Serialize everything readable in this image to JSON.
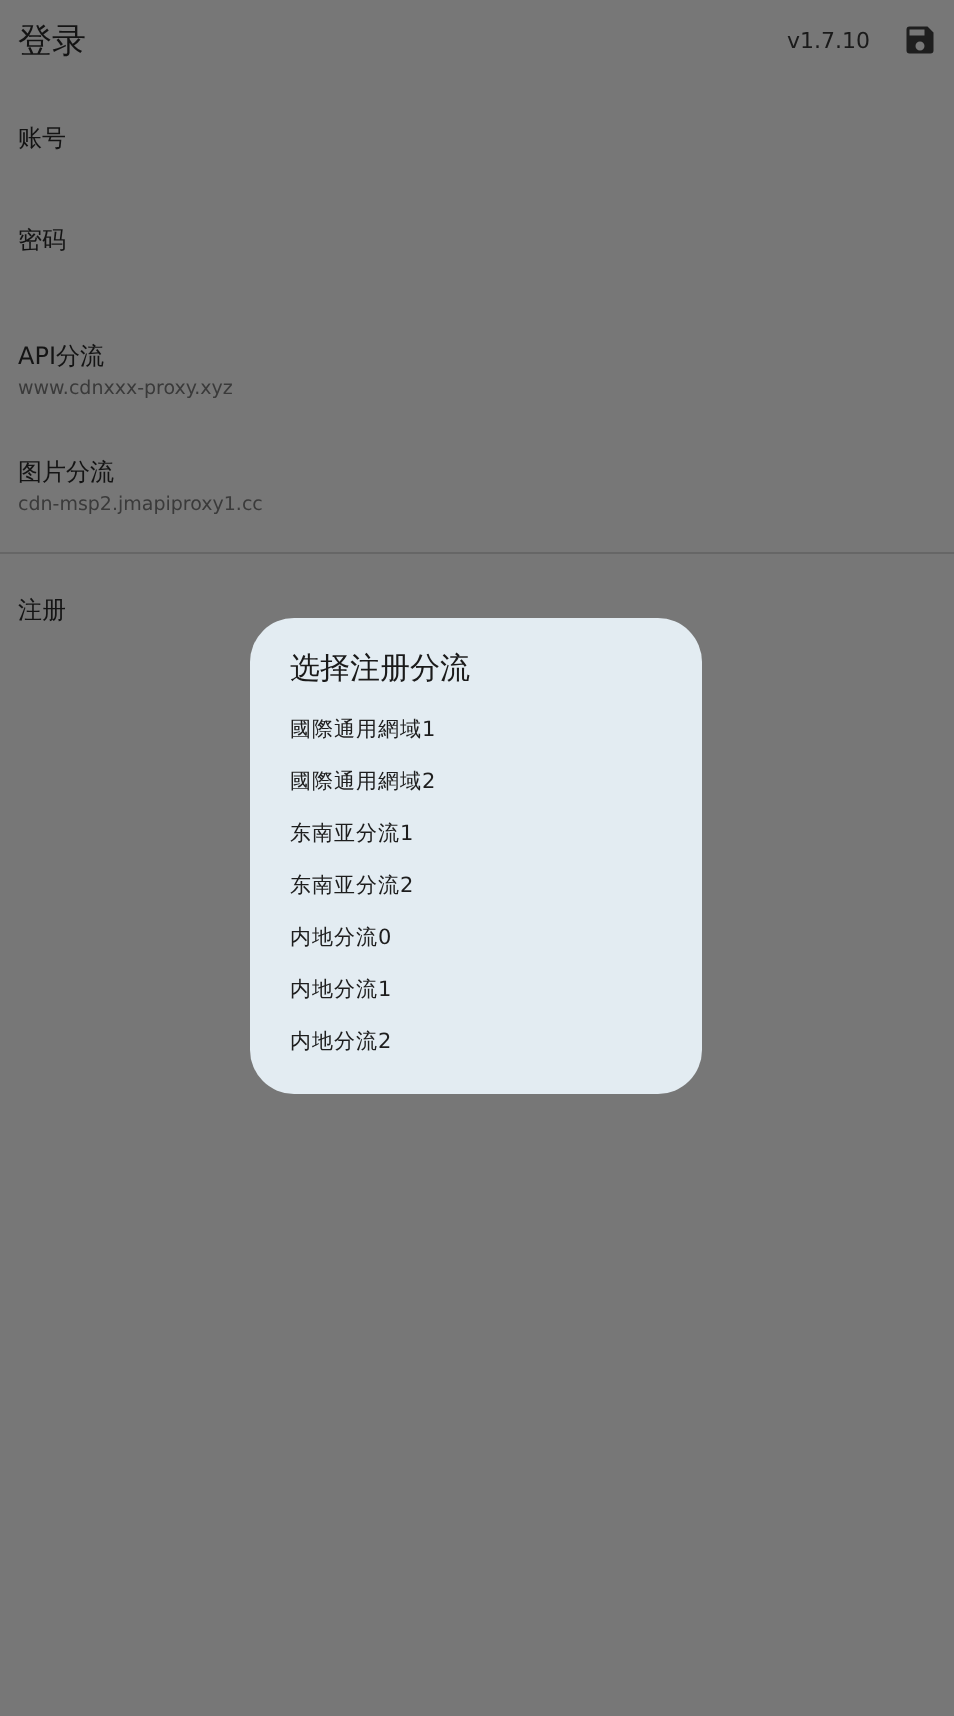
{
  "app_bar": {
    "title": "登录",
    "version": "v1.7.10"
  },
  "fields": [
    {
      "label": "账号"
    },
    {
      "label": "密码"
    },
    {
      "label": "API分流",
      "value": "www.cdnxxx-proxy.xyz"
    },
    {
      "label": "图片分流",
      "value": "cdn-msp2.jmapiproxy1.cc"
    }
  ],
  "register": {
    "label": "注册"
  },
  "dialog": {
    "title": "选择注册分流",
    "options": [
      "國際通用網域1",
      "國際通用網域2",
      "东南亚分流1",
      "东南亚分流2",
      "内地分流0",
      "内地分流1",
      "内地分流2"
    ]
  }
}
